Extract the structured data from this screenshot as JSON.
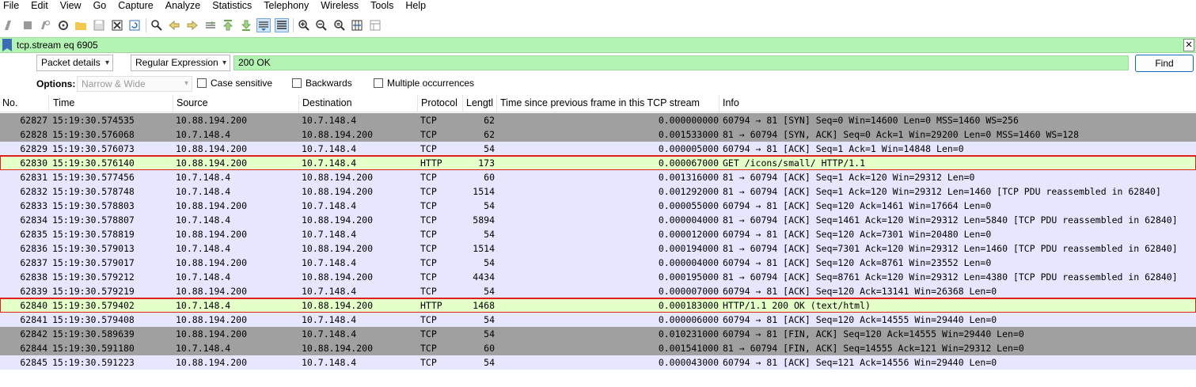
{
  "menu": [
    "File",
    "Edit",
    "View",
    "Go",
    "Capture",
    "Analyze",
    "Statistics",
    "Telephony",
    "Wireless",
    "Tools",
    "Help"
  ],
  "toolbar": {
    "icons": [
      "start-capture-icon",
      "stop-capture-icon",
      "restart-capture-icon",
      "capture-options-icon",
      "open-file-icon",
      "save-file-icon",
      "close-file-icon",
      "reload-file-icon",
      "find-packet-icon",
      "go-back-icon",
      "go-forward-icon",
      "go-to-packet-icon",
      "go-first-packet-icon",
      "go-last-packet-icon",
      "autoscroll-icon",
      "colorize-icon",
      "zoom-in-icon",
      "zoom-out-icon",
      "normal-size-icon",
      "resize-columns-icon",
      "layout-icon"
    ]
  },
  "filter": {
    "value": "tcp.stream eq 6905",
    "bg_color": "#b3f3b3"
  },
  "find": {
    "search_in": "Packet details",
    "search_type": "Regular Expression",
    "search_value": "200 OK",
    "find_label": "Find"
  },
  "options": {
    "label": "Options:",
    "char_width": "Narrow & Wide",
    "case_sensitive": "Case sensitive",
    "backwards": "Backwards",
    "multiple": "Multiple occurrences"
  },
  "columns": [
    "No.",
    "Time",
    "Source",
    "Destination",
    "Protocol",
    "Lengtl",
    "Time since previous frame in this TCP stream",
    "Info"
  ],
  "colors": {
    "tcp_syn_fin": "#a0a0a0",
    "tcp": "#e7e6ff",
    "http": "#e4ffc7",
    "highlight_box": "#e02020"
  },
  "packets": [
    {
      "no": "62827",
      "time": "15:19:30.574535",
      "src": "10.88.194.200",
      "dst": "10.7.148.4",
      "proto": "TCP",
      "len": "62",
      "delta": "0.000000000",
      "info": "60794 → 81 [SYN] Seq=0 Win=14600 Len=0 MSS=1460 WS=256",
      "style": "tcp_syn_fin",
      "highlight": false
    },
    {
      "no": "62828",
      "time": "15:19:30.576068",
      "src": "10.7.148.4",
      "dst": "10.88.194.200",
      "proto": "TCP",
      "len": "62",
      "delta": "0.001533000",
      "info": "81 → 60794 [SYN, ACK] Seq=0 Ack=1 Win=29200 Len=0 MSS=1460 WS=128",
      "style": "tcp_syn_fin",
      "highlight": false
    },
    {
      "no": "62829",
      "time": "15:19:30.576073",
      "src": "10.88.194.200",
      "dst": "10.7.148.4",
      "proto": "TCP",
      "len": "54",
      "delta": "0.000005000",
      "info": "60794 → 81 [ACK] Seq=1 Ack=1 Win=14848 Len=0",
      "style": "tcp",
      "highlight": false
    },
    {
      "no": "62830",
      "time": "15:19:30.576140",
      "src": "10.88.194.200",
      "dst": "10.7.148.4",
      "proto": "HTTP",
      "len": "173",
      "delta": "0.000067000",
      "info": "GET /icons/small/ HTTP/1.1",
      "style": "http",
      "highlight": true
    },
    {
      "no": "62831",
      "time": "15:19:30.577456",
      "src": "10.7.148.4",
      "dst": "10.88.194.200",
      "proto": "TCP",
      "len": "60",
      "delta": "0.001316000",
      "info": "81 → 60794 [ACK] Seq=1 Ack=120 Win=29312 Len=0",
      "style": "tcp",
      "highlight": false
    },
    {
      "no": "62832",
      "time": "15:19:30.578748",
      "src": "10.7.148.4",
      "dst": "10.88.194.200",
      "proto": "TCP",
      "len": "1514",
      "delta": "0.001292000",
      "info": "81 → 60794 [ACK] Seq=1 Ack=120 Win=29312 Len=1460 [TCP PDU reassembled in 62840]",
      "style": "tcp",
      "highlight": false
    },
    {
      "no": "62833",
      "time": "15:19:30.578803",
      "src": "10.88.194.200",
      "dst": "10.7.148.4",
      "proto": "TCP",
      "len": "54",
      "delta": "0.000055000",
      "info": "60794 → 81 [ACK] Seq=120 Ack=1461 Win=17664 Len=0",
      "style": "tcp",
      "highlight": false
    },
    {
      "no": "62834",
      "time": "15:19:30.578807",
      "src": "10.7.148.4",
      "dst": "10.88.194.200",
      "proto": "TCP",
      "len": "5894",
      "delta": "0.000004000",
      "info": "81 → 60794 [ACK] Seq=1461 Ack=120 Win=29312 Len=5840 [TCP PDU reassembled in 62840]",
      "style": "tcp",
      "highlight": false
    },
    {
      "no": "62835",
      "time": "15:19:30.578819",
      "src": "10.88.194.200",
      "dst": "10.7.148.4",
      "proto": "TCP",
      "len": "54",
      "delta": "0.000012000",
      "info": "60794 → 81 [ACK] Seq=120 Ack=7301 Win=20480 Len=0",
      "style": "tcp",
      "highlight": false
    },
    {
      "no": "62836",
      "time": "15:19:30.579013",
      "src": "10.7.148.4",
      "dst": "10.88.194.200",
      "proto": "TCP",
      "len": "1514",
      "delta": "0.000194000",
      "info": "81 → 60794 [ACK] Seq=7301 Ack=120 Win=29312 Len=1460 [TCP PDU reassembled in 62840]",
      "style": "tcp",
      "highlight": false
    },
    {
      "no": "62837",
      "time": "15:19:30.579017",
      "src": "10.88.194.200",
      "dst": "10.7.148.4",
      "proto": "TCP",
      "len": "54",
      "delta": "0.000004000",
      "info": "60794 → 81 [ACK] Seq=120 Ack=8761 Win=23552 Len=0",
      "style": "tcp",
      "highlight": false
    },
    {
      "no": "62838",
      "time": "15:19:30.579212",
      "src": "10.7.148.4",
      "dst": "10.88.194.200",
      "proto": "TCP",
      "len": "4434",
      "delta": "0.000195000",
      "info": "81 → 60794 [ACK] Seq=8761 Ack=120 Win=29312 Len=4380 [TCP PDU reassembled in 62840]",
      "style": "tcp",
      "highlight": false
    },
    {
      "no": "62839",
      "time": "15:19:30.579219",
      "src": "10.88.194.200",
      "dst": "10.7.148.4",
      "proto": "TCP",
      "len": "54",
      "delta": "0.000007000",
      "info": "60794 → 81 [ACK] Seq=120 Ack=13141 Win=26368 Len=0",
      "style": "tcp",
      "highlight": false
    },
    {
      "no": "62840",
      "time": "15:19:30.579402",
      "src": "10.7.148.4",
      "dst": "10.88.194.200",
      "proto": "HTTP",
      "len": "1468",
      "delta": "0.000183000",
      "info": "HTTP/1.1 200 OK  (text/html)",
      "style": "http",
      "highlight": true
    },
    {
      "no": "62841",
      "time": "15:19:30.579408",
      "src": "10.88.194.200",
      "dst": "10.7.148.4",
      "proto": "TCP",
      "len": "54",
      "delta": "0.000006000",
      "info": "60794 → 81 [ACK] Seq=120 Ack=14555 Win=29440 Len=0",
      "style": "tcp",
      "highlight": false
    },
    {
      "no": "62842",
      "time": "15:19:30.589639",
      "src": "10.88.194.200",
      "dst": "10.7.148.4",
      "proto": "TCP",
      "len": "54",
      "delta": "0.010231000",
      "info": "60794 → 81 [FIN, ACK] Seq=120 Ack=14555 Win=29440 Len=0",
      "style": "tcp_syn_fin",
      "highlight": false
    },
    {
      "no": "62844",
      "time": "15:19:30.591180",
      "src": "10.7.148.4",
      "dst": "10.88.194.200",
      "proto": "TCP",
      "len": "60",
      "delta": "0.001541000",
      "info": "81 → 60794 [FIN, ACK] Seq=14555 Ack=121 Win=29312 Len=0",
      "style": "tcp_syn_fin",
      "highlight": false
    },
    {
      "no": "62845",
      "time": "15:19:30.591223",
      "src": "10.88.194.200",
      "dst": "10.7.148.4",
      "proto": "TCP",
      "len": "54",
      "delta": "0.000043000",
      "info": "60794 → 81 [ACK] Seq=121 Ack=14556 Win=29440 Len=0",
      "style": "tcp",
      "highlight": false
    }
  ]
}
